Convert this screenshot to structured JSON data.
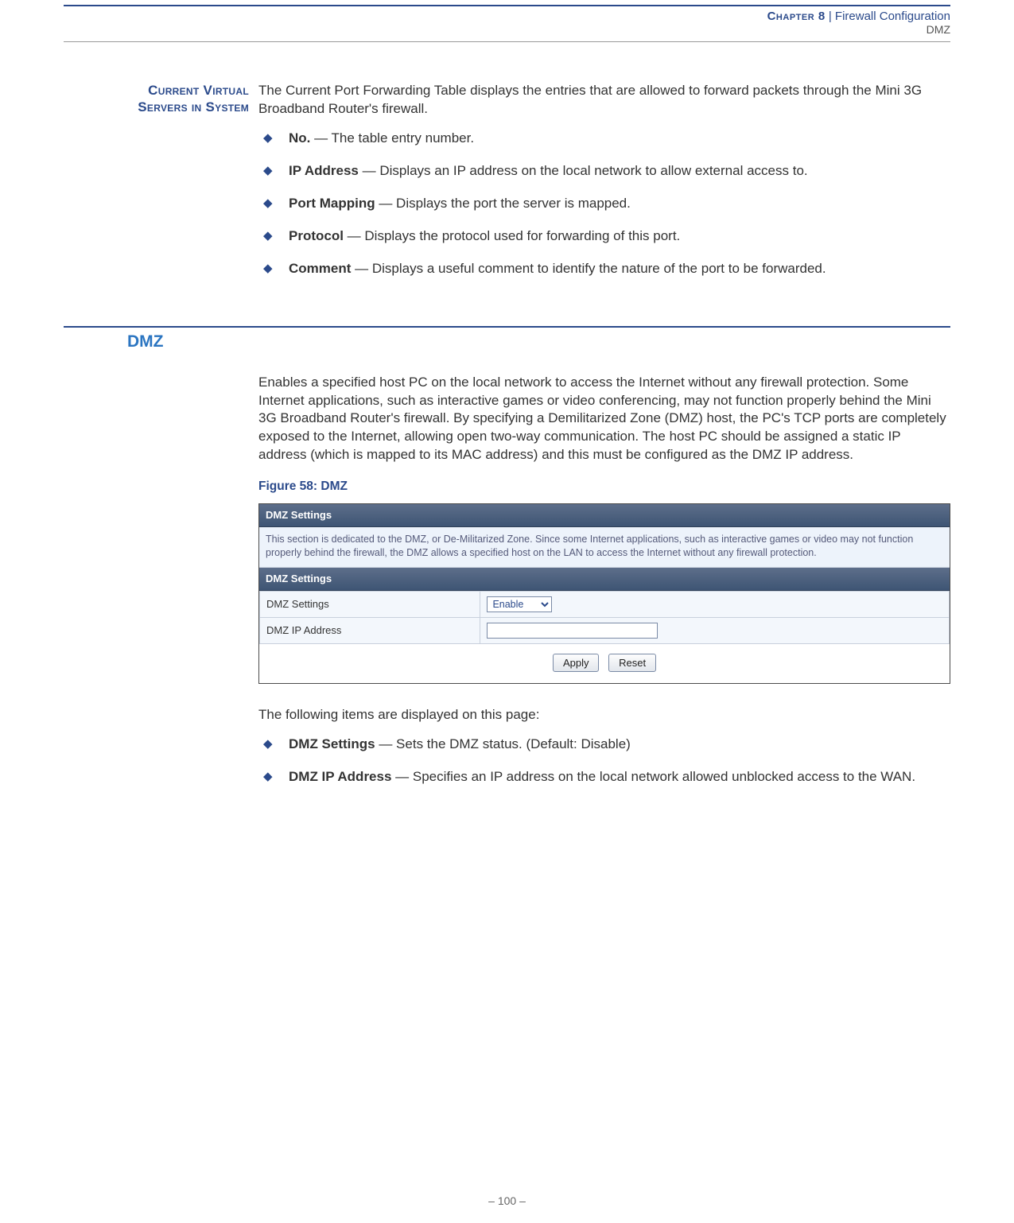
{
  "header": {
    "chapter_label": "Chapter 8",
    "separator": "|",
    "chapter_title": "Firewall Configuration",
    "subsection": "DMZ"
  },
  "virtual_servers": {
    "sidebar_label_line1": "Current Virtual",
    "sidebar_label_line2": "Servers in System",
    "intro": "The Current Port Forwarding Table displays the entries that are allowed to forward packets through the Mini 3G Broadband Router's firewall.",
    "items": [
      {
        "term": "No.",
        "desc": " — The table entry number."
      },
      {
        "term": "IP Address",
        "desc": " — Displays an IP address on the local network to allow external access to."
      },
      {
        "term": "Port Mapping",
        "desc": " — Displays the port the server is mapped."
      },
      {
        "term": "Protocol",
        "desc": " — Displays the protocol used for forwarding of this port."
      },
      {
        "term": "Comment",
        "desc": " — Displays a useful comment to identify the nature of the port to be forwarded."
      }
    ]
  },
  "dmz": {
    "heading": "DMZ",
    "body": "Enables a specified host PC on the local network to access the Internet without any firewall protection. Some Internet applications, such as interactive games or video conferencing, may not function properly behind the Mini 3G Broadband Router's firewall. By specifying a Demilitarized Zone (DMZ) host, the PC's TCP ports are completely exposed to the Internet, allowing open two-way communication. The host PC should be assigned a static IP address (which is mapped to its MAC address) and this must be configured as the DMZ IP address.",
    "figure_caption": "Figure 58:  DMZ",
    "screenshot": {
      "title_bar_1": "DMZ Settings",
      "description": "This section is dedicated to the DMZ, or De-Militarized Zone. Since some Internet applications, such as interactive games or video may not function properly behind the firewall, the DMZ allows a specified host on the LAN to access the Internet without any firewall protection.",
      "title_bar_2": "DMZ Settings",
      "row1_label": "DMZ Settings",
      "row1_select_value": "Enable",
      "row2_label": "DMZ IP Address",
      "row2_input_value": "",
      "btn_apply": "Apply",
      "btn_reset": "Reset"
    },
    "followup_intro": "The following items are displayed on this page:",
    "follow_items": [
      {
        "term": "DMZ Settings",
        "desc": " — Sets the DMZ status. (Default: Disable)"
      },
      {
        "term": "DMZ IP Address",
        "desc": " — Specifies an IP address on the local network allowed unblocked access to the WAN."
      }
    ]
  },
  "footer": {
    "page_number": "–  100  –"
  }
}
